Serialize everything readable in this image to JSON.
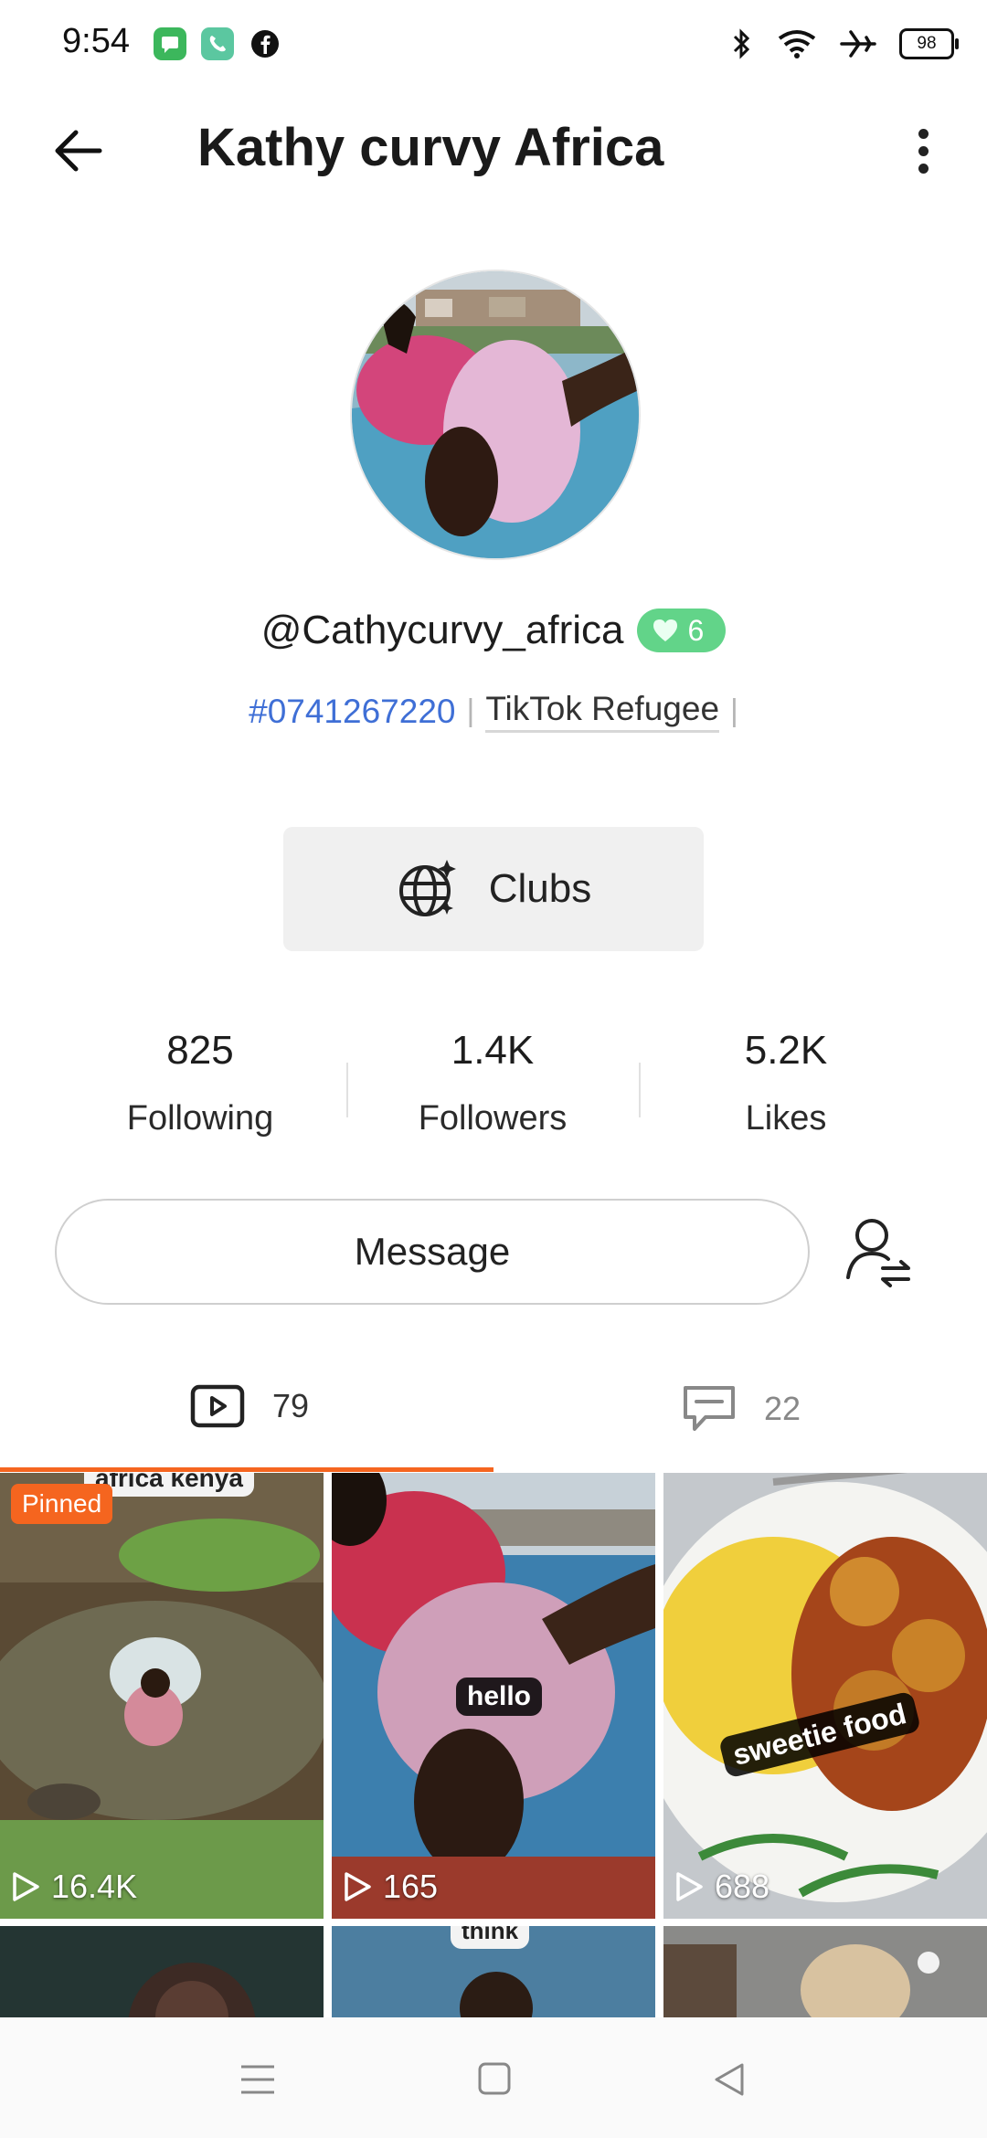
{
  "status_bar": {
    "time": "9:54",
    "battery": "98"
  },
  "header": {
    "title": "Kathy curvy Africa"
  },
  "profile": {
    "handle": "@Cathycurvy_africa",
    "badge_count": "6",
    "bio_phone": "#0741267220",
    "bio_separator": "|",
    "bio_tag": "TikTok Refugee",
    "bio_separator_end": "|"
  },
  "clubs": {
    "label": "Clubs"
  },
  "stats": [
    {
      "value": "825",
      "label": "Following"
    },
    {
      "value": "1.4K",
      "label": "Followers"
    },
    {
      "value": "5.2K",
      "label": "Likes"
    }
  ],
  "message": {
    "label": "Message"
  },
  "tabs": [
    {
      "icon": "video-icon",
      "count": "79",
      "active": true
    },
    {
      "icon": "comment-icon",
      "count": "22",
      "active": false
    }
  ],
  "videos": [
    {
      "pinned_label": "Pinned",
      "caption": "africa kenya",
      "views": "16.4K"
    },
    {
      "caption": "hello",
      "views": "165"
    },
    {
      "caption": "sweetie food",
      "views": "688"
    },
    {
      "caption": ""
    },
    {
      "caption": "think"
    },
    {
      "caption": ""
    }
  ],
  "colors": {
    "accent": "#f5651f",
    "link": "#3f6fd6",
    "badge": "#62d489"
  }
}
